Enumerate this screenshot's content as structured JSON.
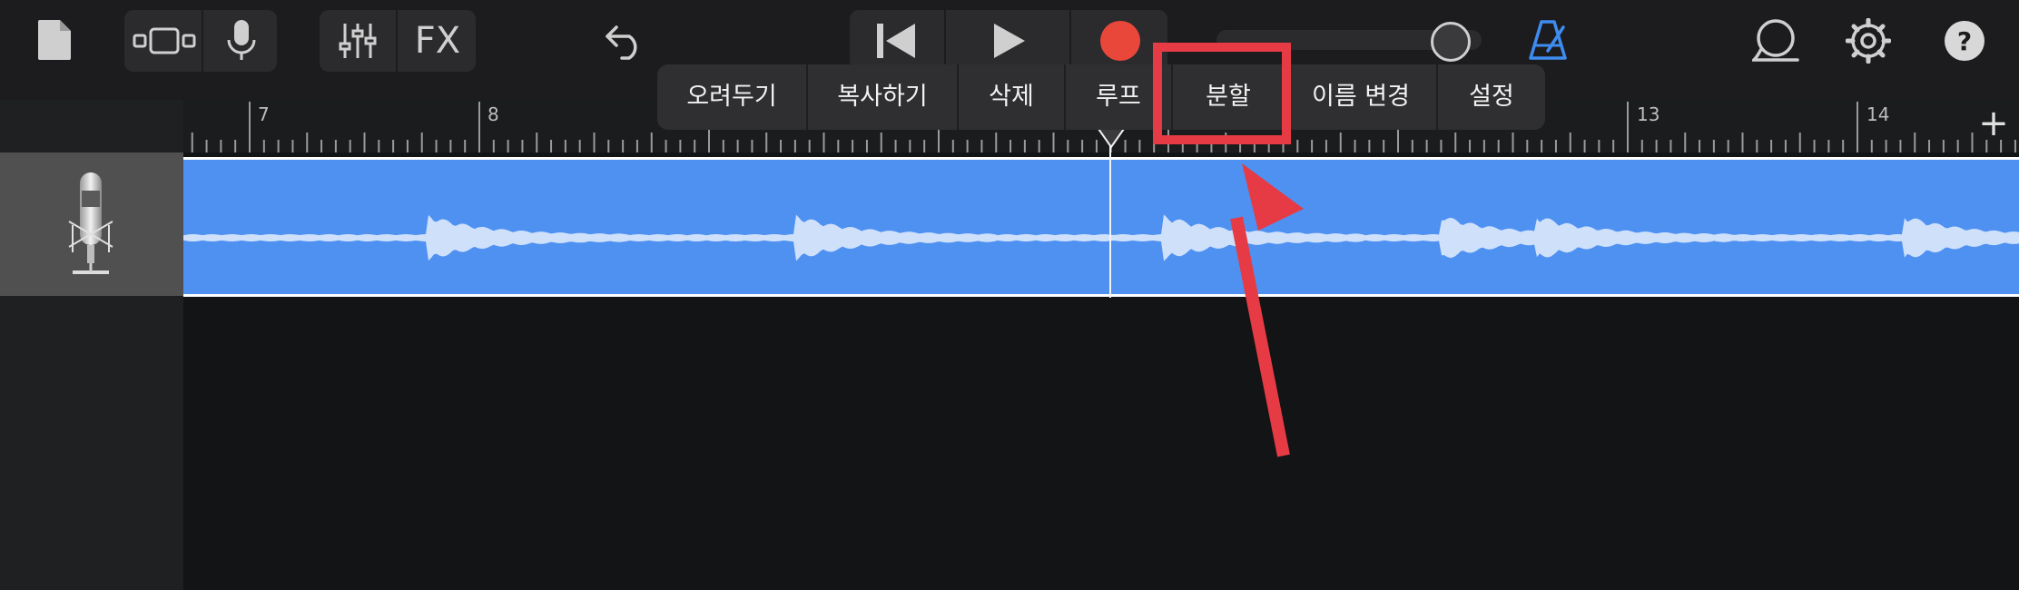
{
  "toolbar": {
    "fx_label": "FX",
    "icons": [
      "document-icon",
      "track-view-icon",
      "microphone-icon",
      "mixer-icon",
      "undo-icon",
      "go-to-start-icon",
      "play-icon",
      "record-icon",
      "metronome-icon",
      "loop-browser-icon",
      "settings-icon",
      "help-icon"
    ],
    "record_color": "#e8473a",
    "metronome_color": "#3e8cf0"
  },
  "ruler": {
    "bars": [
      "7",
      "8",
      "13",
      "14"
    ],
    "add_label": "+"
  },
  "context_menu": {
    "items": [
      "오려두기",
      "복사하기",
      "삭제",
      "루프",
      "분할",
      "이름 변경",
      "설정"
    ],
    "highlighted": "분할",
    "highlight_color": "#e63b44"
  },
  "track": {
    "icon": "condenser-microphone-icon",
    "region_color": "#4e91f1"
  },
  "annotation": {
    "arrow_color": "#e63b44"
  }
}
